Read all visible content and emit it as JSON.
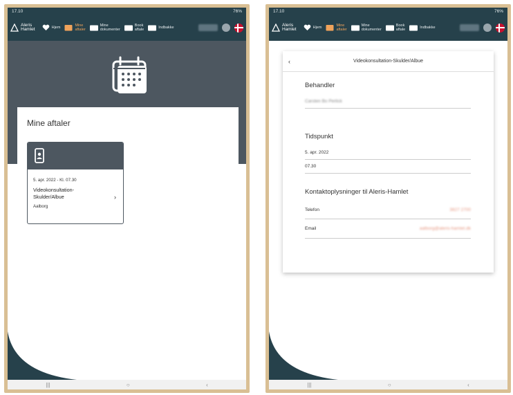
{
  "status_left": "17.10",
  "status_right": "76%",
  "nav": {
    "logo_line1": "Aleris",
    "logo_line2": "Hamlet",
    "home": "Hjem",
    "appointments_1": "Mine",
    "appointments_2": "aftaler",
    "documents_1": "Mine",
    "documents_2": "dokumenter",
    "book_1": "Book",
    "book_2": "aftale",
    "inbox": "Indbakke"
  },
  "left": {
    "section_title": "Mine aftaler",
    "appointment": {
      "date": "5. apr. 2022 - Kl. 07.30",
      "title_line1": "Videokonsultation-",
      "title_line2": "Skulder/Albue",
      "location": "Aalborg",
      "chevron": "›"
    }
  },
  "right": {
    "header_title": "Videokonsultation-Skulder/Albue",
    "back": "‹",
    "behandler_label": "Behandler",
    "behandler_value": "Carsten Bo Perlick",
    "tidspunkt_label": "Tidspunkt",
    "date_value": "5. apr. 2022",
    "time_value": "07.30",
    "contact_label": "Kontaktoplysninger til Aleris-Hamlet",
    "phone_label": "Telefon",
    "phone_value": "3827 2700",
    "email_label": "Email",
    "email_value": "aalborg@aleris-hamlet.dk"
  },
  "sysbar": {
    "recent": "|||",
    "home": "○",
    "back": "‹"
  },
  "colors": {
    "header": "#26414b",
    "accent": "#f0a35b",
    "band": "#4d5760",
    "frame": "#d9bf94"
  }
}
